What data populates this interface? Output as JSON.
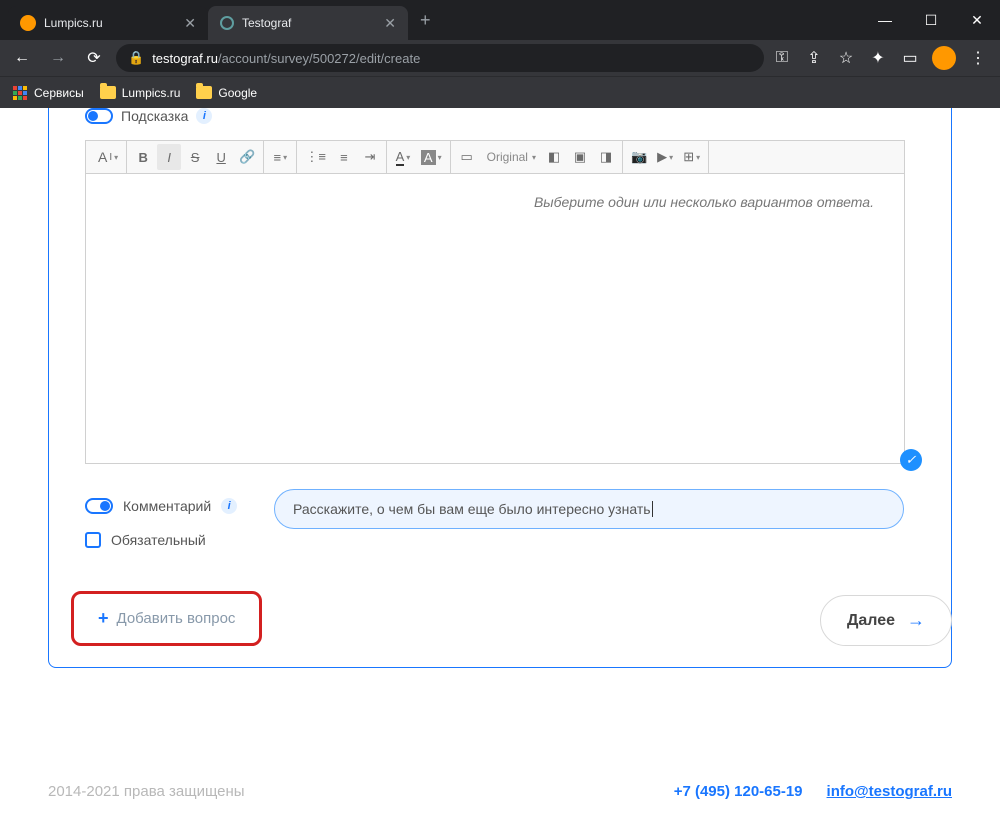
{
  "browser": {
    "tabs": [
      {
        "title": "Lumpics.ru",
        "favicon": "orange",
        "active": false
      },
      {
        "title": "Testograf",
        "favicon": "circle",
        "active": true
      }
    ],
    "url_domain": "testograf.ru",
    "url_path": "/account/survey/500272/edit/create",
    "bookmarks": [
      {
        "label": "Сервисы",
        "icon": "apps"
      },
      {
        "label": "Lumpics.ru",
        "icon": "folder"
      },
      {
        "label": "Google",
        "icon": "folder"
      }
    ]
  },
  "editor": {
    "hint_toggle_label": "Подсказка",
    "placeholder": "Выберите один или несколько вариантов ответа.",
    "toolbar": {
      "font_label": "A",
      "image_size_label": "Original"
    },
    "comment_toggle_label": "Комментарий",
    "comment_input_value": "Расскажите, о чем бы вам еще было интересно узнать",
    "required_label": "Обязательный"
  },
  "actions": {
    "add_question_label": "Добавить вопрос",
    "next_label": "Далее"
  },
  "footer": {
    "copyright": "2014-2021 права защищены",
    "phone": "+7 (495) 120-65-19",
    "email": "info@testograf.ru"
  }
}
